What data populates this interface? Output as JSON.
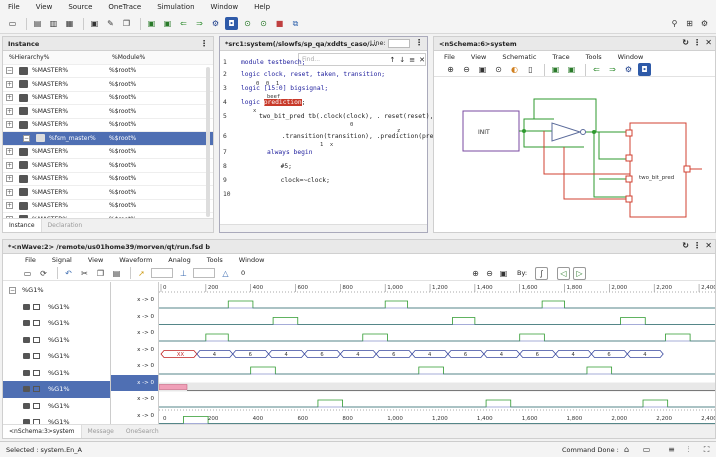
{
  "menu": [
    "File",
    "View",
    "Source",
    "OneTrace",
    "Simulation",
    "Window",
    "Help"
  ],
  "instance": {
    "title": "Instance",
    "col1": "%Hierarchy%",
    "col2": "%Module%",
    "rows": [
      {
        "name": "%MASTER%",
        "module": "%$root%"
      },
      {
        "name": "%MASTER%",
        "module": "%$root%"
      },
      {
        "name": "%MASTER%",
        "module": "%$root%"
      },
      {
        "name": "%MASTER%",
        "module": "%$root%"
      },
      {
        "name": "%MASTER%",
        "module": "%$root%"
      },
      {
        "name": "%fsm_master%",
        "module": "%$root%"
      },
      {
        "name": "%MASTER%",
        "module": "%$root%"
      },
      {
        "name": "%MASTER%",
        "module": "%$root%"
      },
      {
        "name": "%MASTER%",
        "module": "%$root%"
      },
      {
        "name": "%MASTER%",
        "module": "%$root%"
      },
      {
        "name": "%MASTER%",
        "module": "%$root%"
      },
      {
        "name": "%MASTER%",
        "module": "%$root%"
      }
    ],
    "tabs": [
      "Instance",
      "Declaration"
    ]
  },
  "source": {
    "title": "*src1:system(/slowfs/sp_qa/xddts_caso/...",
    "find_placeholder": "Find...",
    "line_label": "Line:",
    "lines": [
      "module testbench;",
      "logic clock, reset, taken, transition;",
      "logic [15:0] bigsignal;",
      "logic prediction;",
      "two_bit_pred tb(.clock(clock), . reset(reset),",
      "      .transition(transition), .prediction(pre",
      "always begin",
      "  #5;",
      "  clock=~clock;",
      ""
    ],
    "annot": [
      "0  0  1",
      "beef",
      "x",
      "0",
      "z",
      "1  x"
    ]
  },
  "schema": {
    "title": "<nSchema:6>system",
    "menu": [
      "File",
      "View",
      "Schematic",
      "Trace",
      "Tools",
      "Window"
    ],
    "init": "INIT",
    "block": "two_bit_pred"
  },
  "wave": {
    "title": "*<nWave:2> /remote/us01home39/morven/qt/run.fsd b",
    "menu": [
      "File",
      "Signal",
      "View",
      "Waveform",
      "Analog",
      "Tools",
      "Window"
    ],
    "cursor": "0",
    "by": "By:",
    "signal_name": "%G1%",
    "group": "%G1%",
    "value": "x -> 0",
    "ticks": [
      "0",
      "200",
      "400",
      "600",
      "800",
      "1,000",
      "1,200",
      "1,400",
      "1,600",
      "1,800",
      "2,000",
      "2,200",
      "2,400"
    ],
    "bus": [
      "XX",
      "4",
      "6",
      "4",
      "6",
      "4",
      "6",
      "4",
      "6",
      "4",
      "6",
      "4",
      "6",
      "4"
    ],
    "tabs": [
      "<nSchema:3>system",
      "Message",
      "OneSearch"
    ]
  },
  "status": {
    "left": "Selected : system.En_A",
    "right": "Command Done :"
  }
}
